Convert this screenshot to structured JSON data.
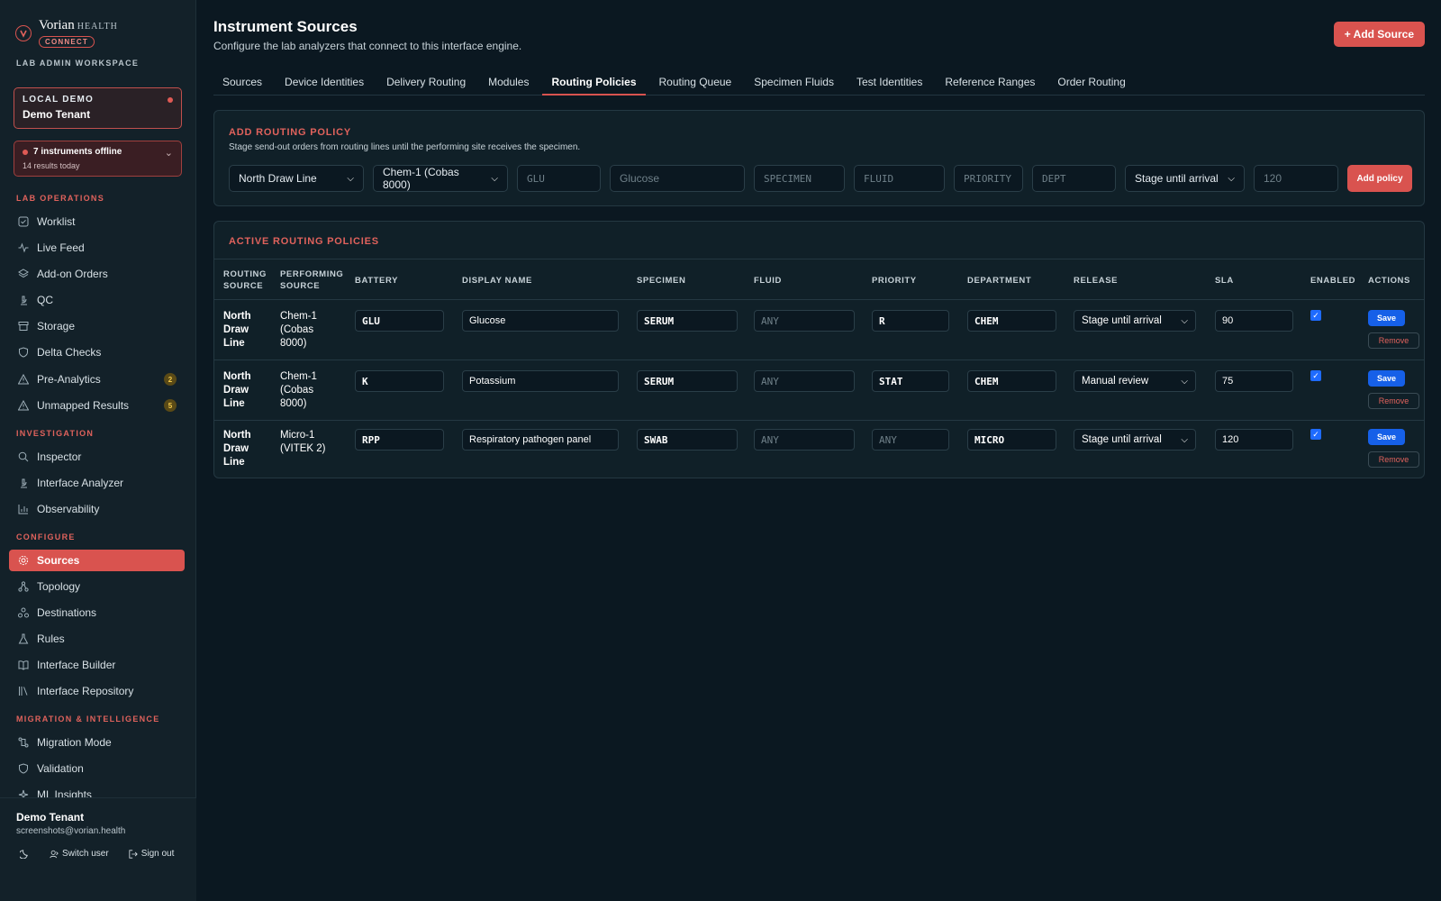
{
  "brand": {
    "name": "Vorian",
    "name_sub": "HEALTH",
    "badge": "CONNECT",
    "workspace": "LAB ADMIN WORKSPACE"
  },
  "tenant_card": {
    "label": "LOCAL DEMO",
    "name": "Demo Tenant"
  },
  "alert": {
    "title": "7 instruments offline",
    "subtitle": "14 results today"
  },
  "nav": {
    "section_lab_ops": "LAB OPERATIONS",
    "worklist": "Worklist",
    "live_feed": "Live Feed",
    "addon_orders": "Add-on Orders",
    "qc": "QC",
    "storage": "Storage",
    "delta_checks": "Delta Checks",
    "pre_analytics": "Pre-Analytics",
    "pre_analytics_count": "2",
    "unmapped_results": "Unmapped Results",
    "unmapped_results_count": "5",
    "section_investigation": "INVESTIGATION",
    "inspector": "Inspector",
    "interface_analyzer": "Interface Analyzer",
    "observability": "Observability",
    "section_configure": "CONFIGURE",
    "sources": "Sources",
    "topology": "Topology",
    "destinations": "Destinations",
    "rules": "Rules",
    "interface_builder": "Interface Builder",
    "interface_repository": "Interface Repository",
    "section_migration": "MIGRATION & INTELLIGENCE",
    "migration_mode": "Migration Mode",
    "validation": "Validation",
    "ml_insights": "ML Insights"
  },
  "user": {
    "name": "Demo Tenant",
    "email": "screenshots@vorian.health",
    "switch_user": "Switch user",
    "sign_out": "Sign out"
  },
  "page": {
    "title": "Instrument Sources",
    "subtitle": "Configure the lab analyzers that connect to this interface engine.",
    "add_source": "+ Add Source"
  },
  "tabs": [
    "Sources",
    "Device Identities",
    "Delivery Routing",
    "Modules",
    "Routing Policies",
    "Routing Queue",
    "Specimen Fluids",
    "Test Identities",
    "Reference Ranges",
    "Order Routing"
  ],
  "add_policy": {
    "title": "ADD ROUTING POLICY",
    "subtitle": "Stage send-out orders from routing lines until the performing site receives the specimen.",
    "routing_source": "North Draw Line",
    "performing_source": "Chem-1 (Cobas 8000)",
    "battery_ph": "GLU",
    "display_ph": "Glucose",
    "specimen_ph": "SPECIMEN",
    "fluid_ph": "FLUID",
    "priority_ph": "PRIORITY",
    "dept_ph": "DEPT",
    "release": "Stage until arrival",
    "sla_ph": "120",
    "button": "Add policy"
  },
  "active": {
    "title": "ACTIVE ROUTING POLICIES",
    "headers": {
      "routing_source_1": "ROUTING",
      "routing_source_2": "SOURCE",
      "performing_source_1": "PERFORMING",
      "performing_source_2": "SOURCE",
      "battery": "BATTERY",
      "display_name": "DISPLAY NAME",
      "specimen": "SPECIMEN",
      "fluid": "FLUID",
      "priority": "PRIORITY",
      "department": "DEPARTMENT",
      "release": "RELEASE",
      "sla": "SLA",
      "enabled": "ENABLED",
      "actions": "ACTIONS"
    },
    "save_label": "Save",
    "remove_label": "Remove",
    "fluid_any": "ANY",
    "priority_any": "ANY",
    "rows": [
      {
        "routing": [
          "North",
          "Draw",
          "Line"
        ],
        "performing": [
          "Chem-1",
          "(Cobas",
          "8000)"
        ],
        "battery": "GLU",
        "display": "Glucose",
        "specimen": "SERUM",
        "priority": "R",
        "department": "CHEM",
        "release": "Stage until arrival",
        "sla": "90"
      },
      {
        "routing": [
          "North",
          "Draw",
          "Line"
        ],
        "performing": [
          "Chem-1",
          "(Cobas",
          "8000)"
        ],
        "battery": "K",
        "display": "Potassium",
        "specimen": "SERUM",
        "priority": "STAT",
        "department": "CHEM",
        "release": "Manual review",
        "sla": "75"
      },
      {
        "routing": [
          "North",
          "Draw",
          "Line"
        ],
        "performing": [
          "Micro-1",
          "(VITEK 2)"
        ],
        "battery": "RPP",
        "display": "Respiratory pathogen panel",
        "specimen": "SWAB",
        "priority": "",
        "department": "MICRO",
        "release": "Stage until arrival",
        "sla": "120"
      }
    ]
  }
}
